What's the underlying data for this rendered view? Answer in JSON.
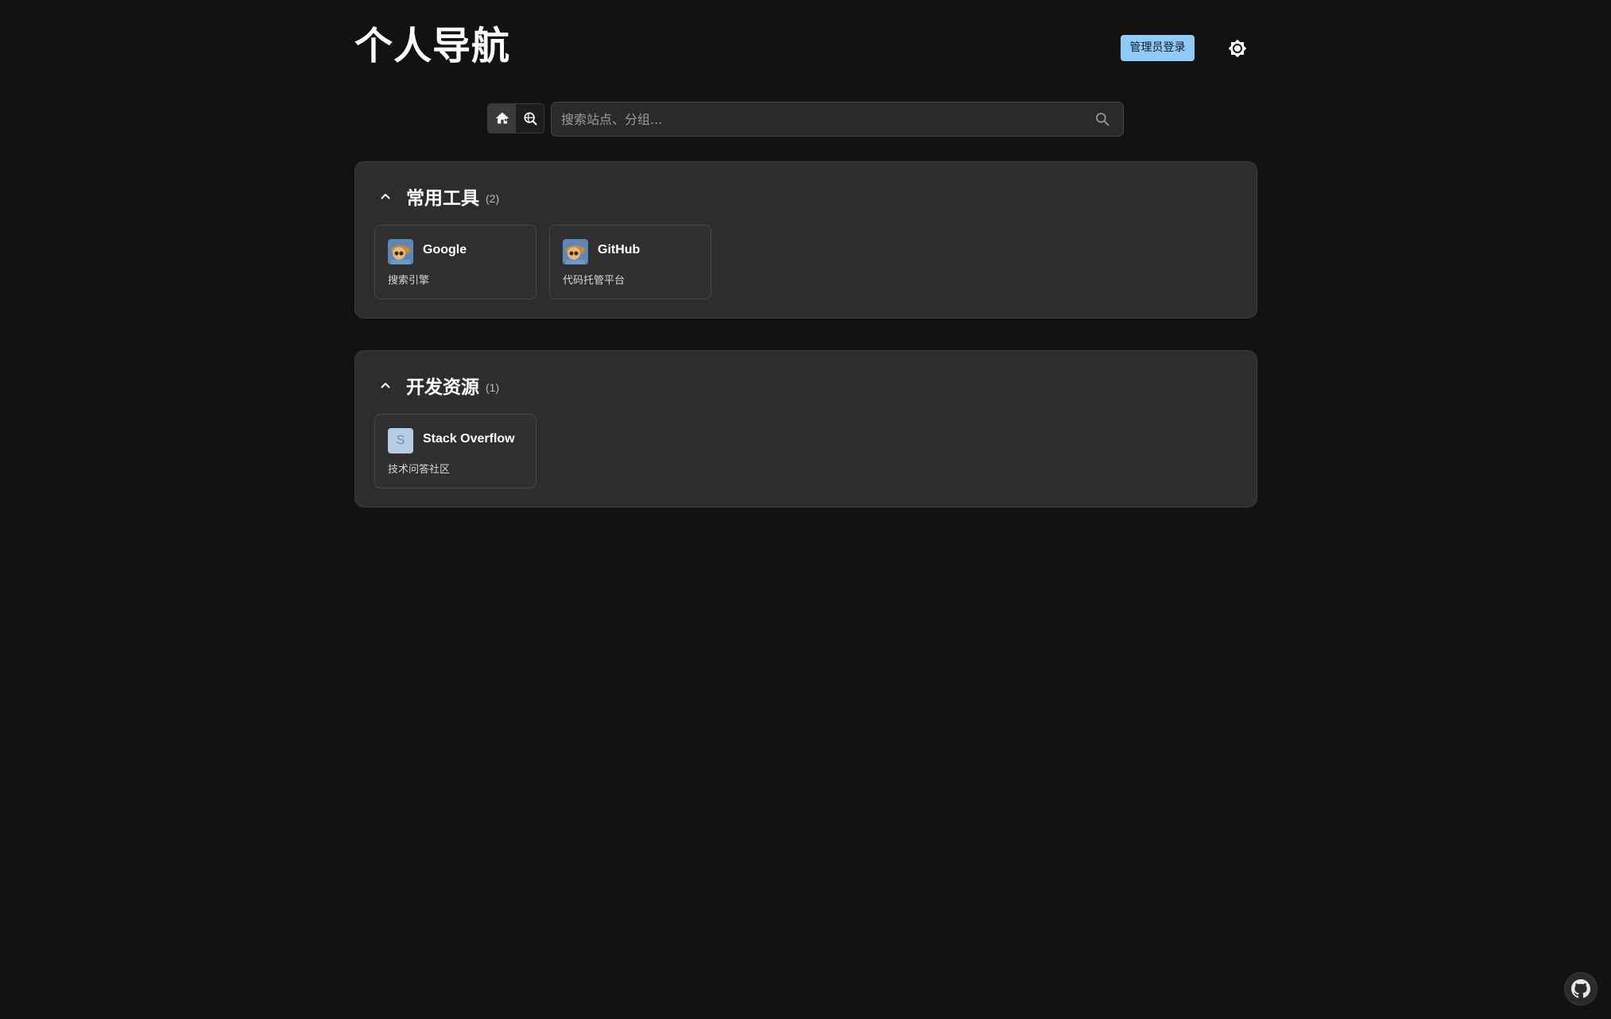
{
  "header": {
    "title": "个人导航",
    "admin_login_label": "管理员登录",
    "theme_icon": "sun-icon"
  },
  "search": {
    "modes": [
      {
        "icon": "home-icon",
        "active": true
      },
      {
        "icon": "web-search-icon",
        "active": false
      }
    ],
    "placeholder": "搜索站点、分组...",
    "icon": "search-icon"
  },
  "groups": [
    {
      "name": "常用工具",
      "count": "(2)",
      "sites": [
        {
          "name": "Google",
          "description": "搜索引擎",
          "icon": "avatar-image"
        },
        {
          "name": "GitHub",
          "description": "代码托管平台",
          "icon": "avatar-image"
        }
      ]
    },
    {
      "name": "开发资源",
      "count": "(1)",
      "sites": [
        {
          "name": "Stack Overflow",
          "description": "技术问答社区",
          "icon_letter": "S"
        }
      ]
    }
  ],
  "footer": {
    "icon": "github-icon"
  },
  "colors": {
    "background": "#121212",
    "card": "#2d2d2d",
    "accent": "#90caf9"
  }
}
